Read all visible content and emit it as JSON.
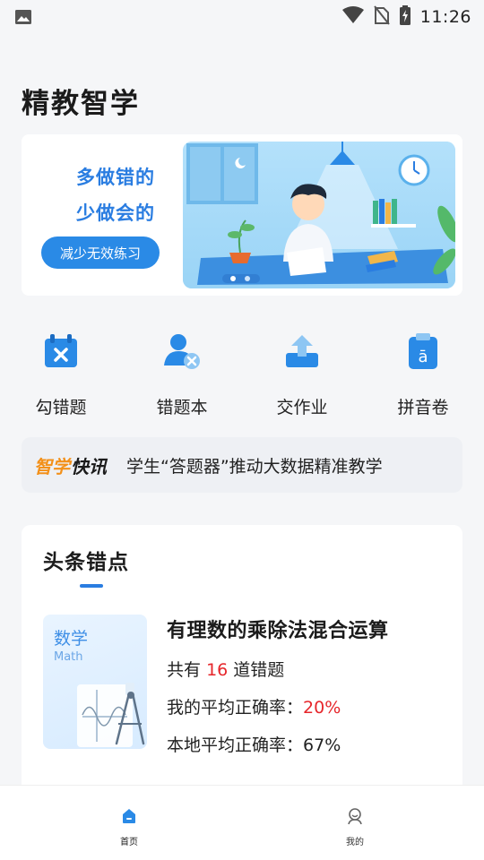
{
  "status_bar": {
    "time": "11:26"
  },
  "app_title": "精教智学",
  "banner": {
    "line1": "多做错的",
    "line2": "少做会的",
    "button": "减少无效练习"
  },
  "features": [
    {
      "label": "勾错题",
      "icon": "calendar-x-icon"
    },
    {
      "label": "错题本",
      "icon": "user-x-icon"
    },
    {
      "label": "交作业",
      "icon": "upload-tray-icon"
    },
    {
      "label": "拼音卷",
      "icon": "pinyin-clipboard-icon"
    }
  ],
  "news": {
    "brand_a": "智学",
    "brand_b": "快讯",
    "text": "学生“答题器”推动大数据精准教学"
  },
  "top_errors": {
    "title": "头条错点",
    "thumb_subject": "数学",
    "thumb_subject_en": "Math",
    "topic": "有理数的乘除法混合运算",
    "count_prefix": "共有",
    "count": "16",
    "count_suffix": "道错题",
    "my_rate_label": "我的平均正确率：",
    "my_rate": "20%",
    "local_rate_label": "本地平均正确率：",
    "local_rate": "67%"
  },
  "tabs": [
    {
      "label": "首页",
      "icon": "home-icon",
      "active": true
    },
    {
      "label": "我的",
      "icon": "profile-icon",
      "active": false
    }
  ],
  "colors": {
    "accent": "#2a7de1",
    "brand_orange": "#f39019",
    "highlight_red": "#e6262b"
  }
}
